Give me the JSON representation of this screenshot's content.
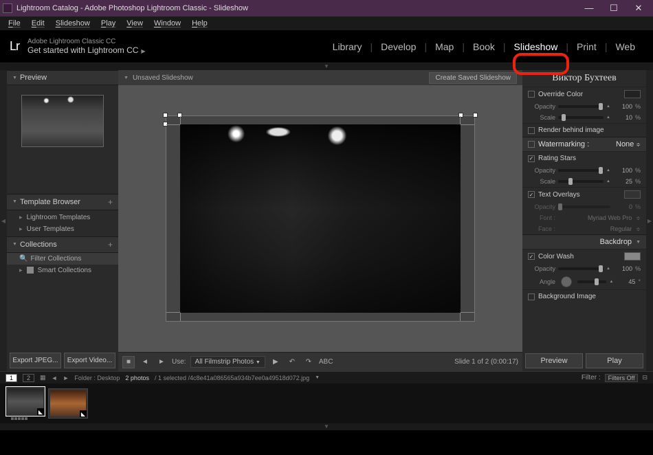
{
  "titlebar": {
    "text": "Lightroom Catalog - Adobe Photoshop Lightroom Classic - Slideshow"
  },
  "menubar": [
    "File",
    "Edit",
    "Slideshow",
    "Play",
    "View",
    "Window",
    "Help"
  ],
  "header": {
    "product": "Adobe Lightroom Classic CC",
    "tagline": "Get started with Lightroom CC"
  },
  "modules": [
    "Library",
    "Develop",
    "Map",
    "Book",
    "Slideshow",
    "Print",
    "Web"
  ],
  "active_module": "Slideshow",
  "left_panel": {
    "preview_label": "Preview",
    "sections": [
      {
        "label": "Template Browser",
        "items": [
          "Lightroom Templates",
          "User Templates"
        ]
      },
      {
        "label": "Collections",
        "filter": "Filter Collections",
        "items": [
          "Smart Collections"
        ]
      }
    ],
    "export_jpeg": "Export JPEG...",
    "export_video": "Export Video..."
  },
  "center": {
    "title": "Unsaved Slideshow",
    "create_saved": "Create Saved Slideshow",
    "use_label": "Use:",
    "use_value": "All Filmstrip Photos",
    "abc": "ABC",
    "slide_status": "Slide 1 of 2 (0:00:17)"
  },
  "right_panel": {
    "identity_name": "Виктор Бухтеев",
    "override_color": "Override Color",
    "opacity_label": "Opacity",
    "scale_label": "Scale",
    "angle_label": "Angle",
    "font_label": "Font :",
    "face_label": "Face :",
    "render_behind": "Render behind image",
    "watermarking": "Watermarking :",
    "watermarking_val": "None",
    "rating_stars": "Rating Stars",
    "text_overlays": "Text Overlays",
    "font_value": "Myriad Web Pro",
    "face_value": "Regular",
    "backdrop": "Backdrop",
    "color_wash": "Color Wash",
    "background_image": "Background Image",
    "preview_btn": "Preview",
    "play_btn": "Play",
    "vals": {
      "opacity1": "100",
      "scale1": "10",
      "opacity2": "100",
      "scale2": "25",
      "opacity3": "0",
      "opacity4": "100",
      "angle": "45"
    }
  },
  "filmstrip": {
    "nums": [
      "1",
      "2"
    ],
    "folder_label": "Folder : Desktop",
    "count": "2 photos",
    "selected": "/ 1 selected  /4c8e41a086565a934b7ee0a49518d072.jpg",
    "filter_label": "Filter :",
    "filter_value": "Filters Off"
  }
}
